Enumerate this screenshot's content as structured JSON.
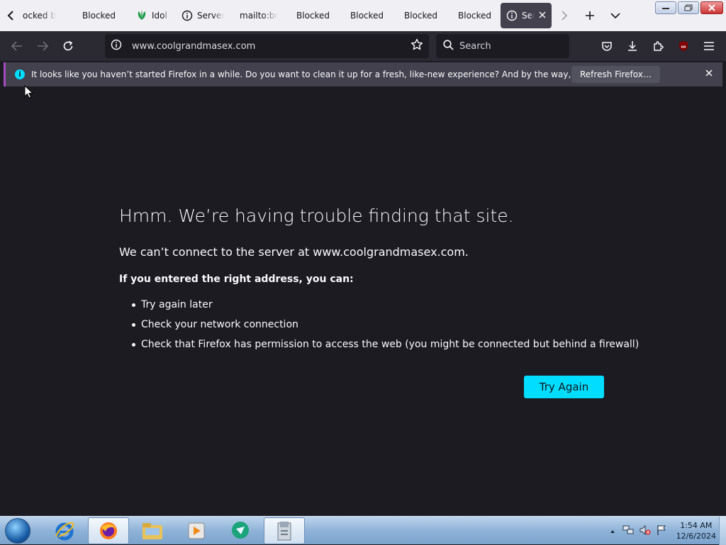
{
  "browser": {
    "tabs": [
      {
        "label": "ocked b",
        "icon": "none",
        "active": false
      },
      {
        "label": "Blocked",
        "icon": "none",
        "active": false
      },
      {
        "label": "Idol V",
        "icon": "leaf-icon",
        "active": false
      },
      {
        "label": "Server",
        "icon": "info-icon",
        "active": false
      },
      {
        "label": "mailto:bri",
        "icon": "none",
        "active": false
      },
      {
        "label": "Blocked",
        "icon": "none",
        "active": false
      },
      {
        "label": "Blocked",
        "icon": "none",
        "active": false
      },
      {
        "label": "Blocked",
        "icon": "none",
        "active": false
      },
      {
        "label": "Blocked",
        "icon": "none",
        "active": false
      },
      {
        "label": "Ser",
        "icon": "info-icon",
        "active": true
      }
    ],
    "address": "www.coolgrandmasex.com",
    "search_placeholder": "Search",
    "notification": {
      "message": "It looks like you haven’t started Firefox in a while. Do you want to clean it up for a fresh, like-new experience? And by the way, welcome back!",
      "button": "Refresh Firefox…"
    }
  },
  "error_page": {
    "title": "Hmm. We’re having trouble finding that site.",
    "subtitle": "We can’t connect to the server at www.coolgrandmasex.com.",
    "hint": "If you entered the right address, you can:",
    "suggestions": [
      "Try again later",
      "Check your network connection",
      "Check that Firefox has permission to access the web (you might be connected but behind a firewall)"
    ],
    "retry_button": "Try Again"
  },
  "taskbar": {
    "time": "1:54 AM",
    "date": "12/6/2024"
  },
  "colors": {
    "accent": "#00ddff",
    "page_bg": "#1c1b22",
    "toolbar_bg": "#2b2a33"
  }
}
